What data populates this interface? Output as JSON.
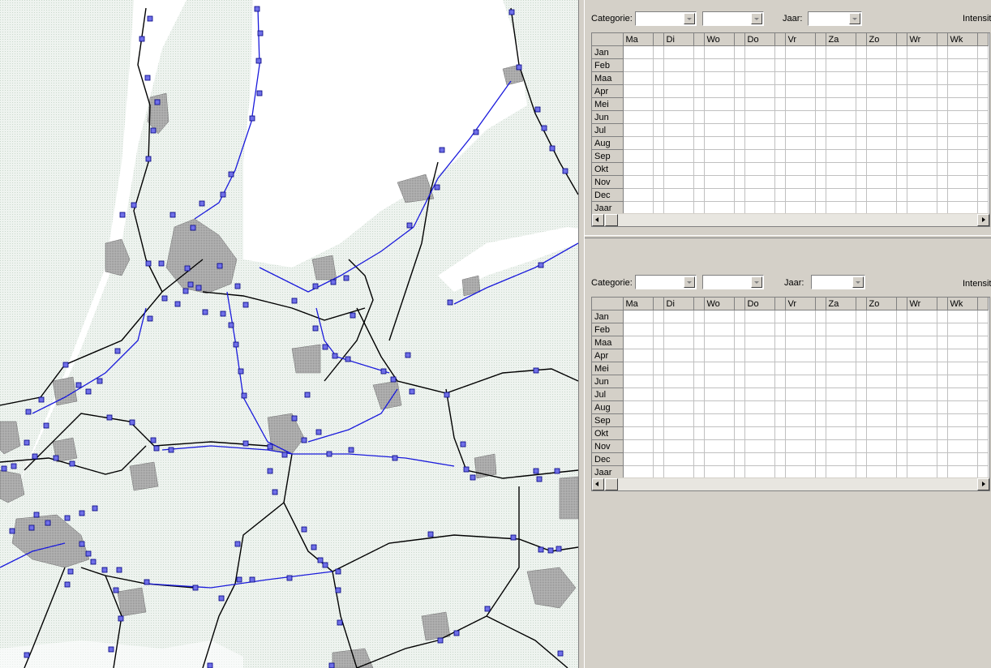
{
  "map": {
    "colors": {
      "land": "#e6eee8",
      "water": "#ffffff",
      "city": "#a8a8a8",
      "road_black": "#000000",
      "road_blue": "#1010c8",
      "station": "#6060e0"
    }
  },
  "panel1": {
    "categorie_label": "Categorie:",
    "categorie_value": "",
    "sub_value": "",
    "jaar_label": "Jaar:",
    "jaar_value": "",
    "intensity_label": "Intensit",
    "columns": [
      "Ma",
      "",
      "Di",
      "",
      "Wo",
      "",
      "Do",
      "",
      "Vr",
      "",
      "Za",
      "",
      "Zo",
      "",
      "Wr",
      "",
      "Wk",
      ""
    ],
    "rows": [
      "Jan",
      "Feb",
      "Maa",
      "Apr",
      "Mei",
      "Jun",
      "Jul",
      "Aug",
      "Sep",
      "Okt",
      "Nov",
      "Dec",
      "Jaar"
    ]
  },
  "panel2": {
    "categorie_label": "Categorie:",
    "categorie_value": "",
    "sub_value": "",
    "jaar_label": "Jaar:",
    "jaar_value": "",
    "intensity_label": "Intensit",
    "columns": [
      "Ma",
      "",
      "Di",
      "",
      "Wo",
      "",
      "Do",
      "",
      "Vr",
      "",
      "Za",
      "",
      "Zo",
      "",
      "Wr",
      "",
      "Wk",
      ""
    ],
    "rows": [
      "Jan",
      "Feb",
      "Maa",
      "Apr",
      "Mei",
      "Jun",
      "Jul",
      "Aug",
      "Sep",
      "Okt",
      "Nov",
      "Dec",
      "Jaar"
    ]
  }
}
